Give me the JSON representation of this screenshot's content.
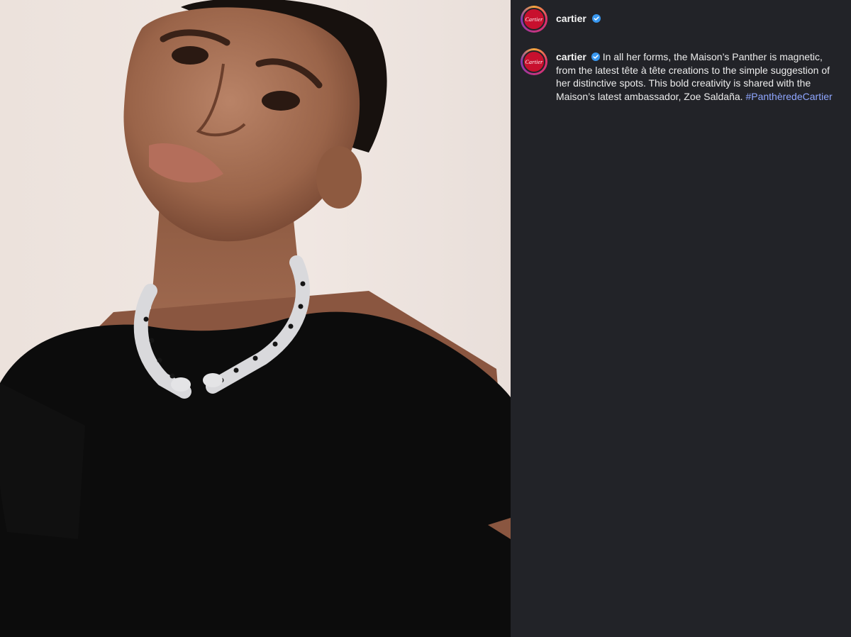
{
  "post": {
    "account": {
      "username": "cartier",
      "verified": true,
      "avatar_logo": "Cartier",
      "avatar_color": "#c8102e"
    },
    "caption": {
      "username": "cartier",
      "text": "In all her forms, the Maison’s Panther is magnetic, from the latest tête à tête creations to the simple suggestion of her distinctive spots. This bold creativity is shared with the Maison’s latest ambassador, Zoe Saldaña.",
      "hashtag": "#PanthèredeCartier"
    },
    "media": {
      "description_icon": "photo-portrait",
      "accent_colors": {
        "background": "#222328",
        "hashtag": "#8fa6ff",
        "verified": "#3897f0"
      }
    }
  }
}
